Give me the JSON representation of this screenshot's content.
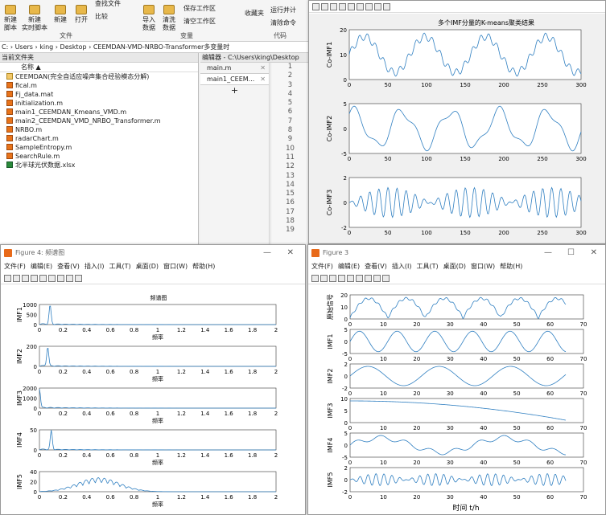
{
  "ribbon": {
    "new_script": "新建\n脚本",
    "new_live": "新建\n实时脚本",
    "new": "新建",
    "open": "打开",
    "find_files": "查找文件",
    "compare": "比较",
    "import": "导入\n数据",
    "clean": "清洗\n数据",
    "save_ws": "保存工作区",
    "clear_ws": "清空工作区",
    "favorites": "收藏夹",
    "run_section": "运行并计",
    "clear_cmd": "清除命令",
    "sec_file": "文件",
    "sec_var": "变量",
    "sec_code": "代码"
  },
  "address": "C: › Users › king › Desktop › CEEMDAN-VMD-NRBO-Transformer多变量时",
  "files": {
    "header": "当前文件夹",
    "col": "名称 ▲",
    "items": [
      {
        "name": "CEEMDAN(完全自适应噪声集合经验模态分解)",
        "type": "folder"
      },
      {
        "name": "fical.m",
        "type": "m"
      },
      {
        "name": "Fj_data.mat",
        "type": "m"
      },
      {
        "name": "initialization.m",
        "type": "m"
      },
      {
        "name": "main1_CEEMDAN_Kmeans_VMD.m",
        "type": "m"
      },
      {
        "name": "main2_CEEMDAN_VMD_NRBO_Transformer.m",
        "type": "m"
      },
      {
        "name": "NRBO.m",
        "type": "m"
      },
      {
        "name": "radarChart.m",
        "type": "m"
      },
      {
        "name": "SampleEntropy.m",
        "type": "m"
      },
      {
        "name": "SearchRule.m",
        "type": "m"
      },
      {
        "name": "北半球光伏数据.xlsx",
        "type": "xlsx"
      }
    ]
  },
  "editor": {
    "header": "编辑器 - C:\\Users\\king\\Desktop",
    "tabs": [
      "main.m",
      "main1_CEEM..."
    ],
    "add": "+",
    "lines": [
      "1",
      "2",
      "3",
      "4",
      "5",
      "6",
      "7",
      "8",
      "9",
      "10",
      "11",
      "12",
      "13",
      "14",
      "15",
      "16",
      "17",
      "18",
      "19"
    ]
  },
  "fig_top": {
    "title": "多个IMF分量的K-means聚类结果",
    "plots": [
      {
        "label": "Co-IMF1",
        "yticks": [
          "0",
          "10",
          "20"
        ],
        "xticks": [
          "0",
          "50",
          "100",
          "150",
          "200",
          "250",
          "300"
        ]
      },
      {
        "label": "Co-IMF2",
        "yticks": [
          "-5",
          "0",
          "5"
        ],
        "xticks": [
          "0",
          "50",
          "100",
          "150",
          "200",
          "250",
          "300"
        ]
      },
      {
        "label": "Co-IMF3",
        "yticks": [
          "-2",
          "0",
          "2"
        ],
        "xticks": [
          "0",
          "50",
          "100",
          "150",
          "200",
          "250",
          "300"
        ]
      }
    ]
  },
  "fig4": {
    "window_title": "Figure 4: 频谱图",
    "menu": [
      "文件(F)",
      "编辑(E)",
      "查看(V)",
      "插入(I)",
      "工具(T)",
      "桌面(D)",
      "窗口(W)",
      "帮助(H)"
    ],
    "title": "频谱图",
    "xlabel": "频率",
    "xticks": [
      "0",
      "0.2",
      "0.4",
      "0.6",
      "0.8",
      "1",
      "1.2",
      "1.4",
      "1.6",
      "1.8",
      "2"
    ],
    "plots": [
      {
        "label": "IMF1",
        "yticks": [
          "0",
          "500",
          "1000"
        ]
      },
      {
        "label": "IMF2",
        "yticks": [
          "0",
          "200"
        ]
      },
      {
        "label": "IMF3",
        "yticks": [
          "0",
          "1000",
          "2000"
        ]
      },
      {
        "label": "IMF4",
        "yticks": [
          "0",
          "50"
        ]
      },
      {
        "label": "IMF5",
        "yticks": [
          "0",
          "20",
          "40"
        ]
      }
    ]
  },
  "fig3": {
    "window_title": "Figure 3",
    "menu": [
      "文件(F)",
      "编辑(E)",
      "查看(V)",
      "插入(I)",
      "工具(T)",
      "桌面(D)",
      "窗口(W)",
      "帮助(H)"
    ],
    "xlabel": "时间 t/h",
    "xticks": [
      "0",
      "10",
      "20",
      "30",
      "40",
      "50",
      "60",
      "70"
    ],
    "plots": [
      {
        "label": "原始信号",
        "yticks": [
          "0",
          "10",
          "20"
        ]
      },
      {
        "label": "IMF1",
        "yticks": [
          "-5",
          "0",
          "5"
        ]
      },
      {
        "label": "IMF2",
        "yticks": [
          "-2",
          "0",
          "2"
        ]
      },
      {
        "label": "IMF3",
        "yticks": [
          "0",
          "5",
          "10"
        ]
      },
      {
        "label": "IMF4",
        "yticks": [
          "-5",
          "0",
          "5"
        ]
      },
      {
        "label": "IMF5",
        "yticks": [
          "-2",
          "0",
          "2"
        ]
      }
    ]
  },
  "colors": {
    "line": "#2f7fc1",
    "accent": "#e86a1a"
  }
}
